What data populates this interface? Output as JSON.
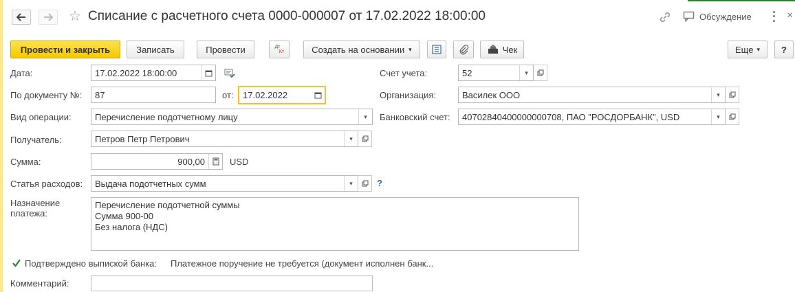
{
  "header": {
    "title": "Списание с расчетного счета 0000-000007 от 17.02.2022 18:00:00",
    "discussion_label": "Обсуждение"
  },
  "toolbar": {
    "post_close": "Провести и закрыть",
    "save": "Записать",
    "post": "Провести",
    "dtkt_top": "Дт",
    "dtkt_bottom": "Кт",
    "create_based": "Создать на основании",
    "check": "Чек",
    "more": "Еще",
    "help": "?"
  },
  "form": {
    "date_label": "Дата:",
    "date_value": "17.02.2022 18:00:00",
    "doc_no_label": "По документу №:",
    "doc_no_value": "87",
    "from_label": "от:",
    "from_value": "17.02.2022",
    "operation_label": "Вид операции:",
    "operation_value": "Перечисление подотчетному лицу",
    "recipient_label": "Получатель:",
    "recipient_value": "Петров Петр Петрович",
    "amount_label": "Сумма:",
    "amount_value": "900,00",
    "currency": "USD",
    "expense_label": "Статья расходов:",
    "expense_value": "Выдача подотчетных сумм",
    "expense_help": "?",
    "purpose_label_1": "Назначение",
    "purpose_label_2": "платежа:",
    "purpose_lines": [
      "Перечисление подотчетной суммы",
      "Сумма 900-00",
      "Без налога (НДС)"
    ],
    "confirmed_label": "Подтверждено выпиской банка:",
    "confirmed_checked": true,
    "payment_order_text": "Платежное поручение не требуется (документ исполнен банк...",
    "comment_label": "Комментарий:",
    "comment_value": "",
    "account_label": "Счет учета:",
    "account_value": "52",
    "org_label": "Организация:",
    "org_value": "Василек ООО",
    "bank_label": "Банковский счет:",
    "bank_value": "40702840400000000708, ПАО \"РОСДОРБАНК\", USD"
  },
  "colors": {
    "accent_yellow": "#f4c800",
    "focus_border": "#f2c12e",
    "help_blue": "#1b6ec2",
    "check_green": "#2e7d32"
  }
}
